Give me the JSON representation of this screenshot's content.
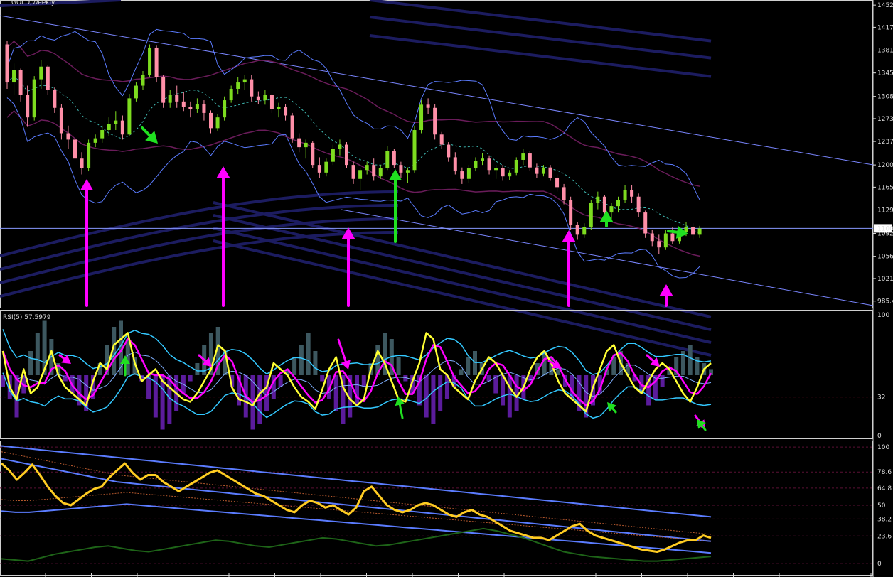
{
  "window": {
    "title": "GOLD,Weekly"
  },
  "colors": {
    "background": "#000000",
    "bull": "#7ddc1f",
    "bear": "#ff8fa8",
    "bands_blue": "#5b7cff",
    "bands_purple": "#6a1c5a",
    "trendline": "#7a86ff",
    "ema_dark": "#1c1c60",
    "arrow_magenta": "#ff00ff",
    "arrow_green": "#20e020",
    "rsi": "#ffff33",
    "rsi_bands": "#33c8ff",
    "hist_pos": "#3d5860",
    "hist_neg": "#5b1c9c",
    "stoch_main": "#ffcc22",
    "stoch_green": "#1e6418",
    "stoch_blue": "#5b7cff",
    "stoch_dashed": "#b85a2e",
    "level_dotted": "#a01030"
  },
  "chart_data": [
    {
      "type": "candlestick",
      "title": "GOLD,Weekly",
      "price_ticks": [
        "1452",
        "1417",
        "1381",
        "1345",
        "1308",
        "1273",
        "1237",
        "1200",
        "1165",
        "1129",
        "1092",
        "1056",
        "1021",
        "985.4"
      ],
      "price_tick_values": [
        1452,
        1417,
        1381,
        1345,
        1308,
        1273,
        1237,
        1200,
        1165,
        1129,
        1092,
        1056,
        1021,
        985.4
      ],
      "current_price_label": "1100",
      "current_price": 1100,
      "ylim": [
        975,
        1460
      ],
      "candles": [
        [
          1390,
          1395,
          1320,
          1330
        ],
        [
          1330,
          1360,
          1310,
          1350
        ],
        [
          1350,
          1352,
          1300,
          1310
        ],
        [
          1310,
          1325,
          1260,
          1275
        ],
        [
          1275,
          1340,
          1270,
          1335
        ],
        [
          1335,
          1365,
          1320,
          1355
        ],
        [
          1355,
          1358,
          1310,
          1318
        ],
        [
          1318,
          1322,
          1282,
          1290
        ],
        [
          1290,
          1296,
          1240,
          1250
        ],
        [
          1250,
          1262,
          1225,
          1240
        ],
        [
          1240,
          1250,
          1200,
          1210
        ],
        [
          1210,
          1220,
          1185,
          1195
        ],
        [
          1195,
          1240,
          1190,
          1235
        ],
        [
          1235,
          1248,
          1228,
          1242
        ],
        [
          1242,
          1262,
          1235,
          1255
        ],
        [
          1255,
          1275,
          1245,
          1265
        ],
        [
          1265,
          1285,
          1255,
          1270
        ],
        [
          1270,
          1278,
          1240,
          1248
        ],
        [
          1248,
          1312,
          1245,
          1305
        ],
        [
          1305,
          1330,
          1300,
          1325
        ],
        [
          1325,
          1348,
          1318,
          1342
        ],
        [
          1342,
          1390,
          1338,
          1385
        ],
        [
          1385,
          1388,
          1330,
          1338
        ],
        [
          1338,
          1342,
          1290,
          1298
        ],
        [
          1298,
          1318,
          1290,
          1310
        ],
        [
          1310,
          1325,
          1290,
          1300
        ],
        [
          1300,
          1315,
          1285,
          1292
        ],
        [
          1292,
          1300,
          1275,
          1288
        ],
        [
          1288,
          1305,
          1282,
          1296
        ],
        [
          1296,
          1302,
          1270,
          1282
        ],
        [
          1282,
          1286,
          1250,
          1258
        ],
        [
          1258,
          1280,
          1254,
          1275
        ],
        [
          1275,
          1308,
          1270,
          1302
        ],
        [
          1302,
          1325,
          1298,
          1320
        ],
        [
          1320,
          1338,
          1312,
          1330
        ],
        [
          1330,
          1342,
          1318,
          1335
        ],
        [
          1335,
          1342,
          1300,
          1308
        ],
        [
          1308,
          1316,
          1296,
          1302
        ],
        [
          1302,
          1318,
          1295,
          1310
        ],
        [
          1310,
          1312,
          1282,
          1288
        ],
        [
          1288,
          1298,
          1275,
          1292
        ],
        [
          1292,
          1296,
          1270,
          1278
        ],
        [
          1278,
          1282,
          1235,
          1242
        ],
        [
          1242,
          1250,
          1220,
          1228
        ],
        [
          1228,
          1240,
          1210,
          1235
        ],
        [
          1235,
          1238,
          1195,
          1200
        ],
        [
          1200,
          1212,
          1180,
          1188
        ],
        [
          1188,
          1210,
          1182,
          1205
        ],
        [
          1205,
          1232,
          1200,
          1225
        ],
        [
          1225,
          1240,
          1215,
          1232
        ],
        [
          1232,
          1236,
          1195,
          1200
        ],
        [
          1200,
          1205,
          1170,
          1178
        ],
        [
          1178,
          1195,
          1160,
          1192
        ],
        [
          1192,
          1205,
          1185,
          1200
        ],
        [
          1200,
          1210,
          1175,
          1182
        ],
        [
          1182,
          1200,
          1178,
          1195
        ],
        [
          1195,
          1230,
          1192,
          1222
        ],
        [
          1222,
          1225,
          1195,
          1200
        ],
        [
          1200,
          1205,
          1180,
          1188
        ],
        [
          1188,
          1196,
          1172,
          1192
        ],
        [
          1192,
          1262,
          1188,
          1255
        ],
        [
          1255,
          1302,
          1250,
          1295
        ],
        [
          1295,
          1305,
          1280,
          1290
        ],
        [
          1290,
          1296,
          1240,
          1248
        ],
        [
          1248,
          1252,
          1225,
          1232
        ],
        [
          1232,
          1236,
          1205,
          1212
        ],
        [
          1212,
          1220,
          1185,
          1190
        ],
        [
          1190,
          1196,
          1170,
          1178
        ],
        [
          1178,
          1200,
          1172,
          1195
        ],
        [
          1195,
          1212,
          1190,
          1206
        ],
        [
          1206,
          1218,
          1200,
          1210
        ],
        [
          1210,
          1215,
          1185,
          1192
        ],
        [
          1192,
          1200,
          1178,
          1195
        ],
        [
          1195,
          1200,
          1175,
          1182
        ],
        [
          1182,
          1192,
          1176,
          1188
        ],
        [
          1188,
          1212,
          1184,
          1208
        ],
        [
          1208,
          1225,
          1200,
          1218
        ],
        [
          1218,
          1222,
          1190,
          1196
        ],
        [
          1196,
          1202,
          1180,
          1186
        ],
        [
          1186,
          1200,
          1182,
          1196
        ],
        [
          1196,
          1200,
          1175,
          1180
        ],
        [
          1180,
          1185,
          1158,
          1165
        ],
        [
          1165,
          1170,
          1138,
          1145
        ],
        [
          1145,
          1150,
          1098,
          1105
        ],
        [
          1105,
          1110,
          1082,
          1090
        ],
        [
          1090,
          1108,
          1085,
          1102
        ],
        [
          1102,
          1145,
          1098,
          1140
        ],
        [
          1140,
          1158,
          1130,
          1150
        ],
        [
          1150,
          1152,
          1118,
          1125
        ],
        [
          1125,
          1140,
          1110,
          1135
        ],
        [
          1135,
          1150,
          1125,
          1145
        ],
        [
          1145,
          1168,
          1140,
          1160
        ],
        [
          1160,
          1168,
          1140,
          1150
        ],
        [
          1150,
          1155,
          1118,
          1125
        ],
        [
          1125,
          1128,
          1085,
          1092
        ],
        [
          1092,
          1098,
          1072,
          1080
        ],
        [
          1080,
          1090,
          1060,
          1070
        ],
        [
          1070,
          1098,
          1066,
          1092
        ],
        [
          1092,
          1102,
          1075,
          1080
        ],
        [
          1080,
          1098,
          1076,
          1094
        ],
        [
          1094,
          1110,
          1088,
          1102
        ],
        [
          1102,
          1108,
          1082,
          1090
        ],
        [
          1090,
          1104,
          1085,
          1100
        ]
      ]
    },
    {
      "type": "line",
      "title": "RSI(5) 57.5979",
      "ticks": [
        "100",
        "32",
        "0"
      ],
      "tick_values": [
        100,
        32,
        0
      ],
      "ylim": [
        0,
        100
      ],
      "level": 32,
      "rsi": [
        70,
        40,
        30,
        55,
        35,
        40,
        55,
        70,
        50,
        40,
        35,
        30,
        25,
        45,
        60,
        55,
        75,
        80,
        85,
        60,
        45,
        50,
        55,
        45,
        40,
        35,
        30,
        28,
        35,
        45,
        55,
        75,
        70,
        40,
        30,
        28,
        25,
        35,
        40,
        60,
        55,
        50,
        40,
        32,
        28,
        22,
        38,
        55,
        65,
        40,
        30,
        25,
        30,
        55,
        70,
        60,
        45,
        30,
        28,
        45,
        60,
        85,
        80,
        55,
        50,
        40,
        35,
        30,
        45,
        55,
        65,
        60,
        50,
        40,
        32,
        40,
        55,
        65,
        70,
        60,
        45,
        35,
        30,
        25,
        20,
        40,
        55,
        70,
        75,
        60,
        50,
        40,
        35,
        45,
        55,
        60,
        55,
        45,
        35,
        28,
        40,
        55,
        60
      ],
      "histogram": [
        -10,
        -20,
        -35,
        -15,
        20,
        35,
        45,
        30,
        10,
        -5,
        -15,
        -25,
        -30,
        -20,
        10,
        25,
        40,
        45,
        30,
        15,
        -5,
        -20,
        -35,
        -45,
        -40,
        -30,
        -15,
        -5,
        10,
        25,
        35,
        40,
        20,
        -10,
        -25,
        -35,
        -45,
        -40,
        -30,
        -20,
        -10,
        5,
        15,
        25,
        35,
        20,
        -5,
        -20,
        -30,
        -40,
        -35,
        -25,
        -10,
        10,
        25,
        35,
        30,
        15,
        -5,
        -15,
        -25,
        -35,
        -40,
        -30,
        -20,
        -10,
        5,
        15,
        20,
        10,
        -5,
        -15,
        -25,
        -35,
        -30,
        -20,
        -5,
        10,
        20,
        15,
        5,
        -10,
        -20,
        -30,
        -35,
        -25,
        -15,
        5,
        15,
        20,
        10,
        -5,
        -15,
        -25,
        -20,
        -10,
        5,
        15,
        20,
        25,
        15,
        10,
        5
      ]
    },
    {
      "type": "line",
      "title": "",
      "ticks": [
        "100",
        "78.6",
        "64.8",
        "50",
        "38.2",
        "23.6",
        "0"
      ],
      "tick_values": [
        100,
        78.6,
        64.8,
        50,
        38.2,
        23.6,
        0
      ],
      "ylim": [
        -8,
        105
      ],
      "main": [
        86,
        80,
        72,
        78,
        85,
        76,
        66,
        58,
        52,
        50,
        55,
        60,
        64,
        66,
        74,
        80,
        86,
        78,
        72,
        76,
        76,
        70,
        66,
        62,
        66,
        70,
        74,
        78,
        80,
        76,
        72,
        68,
        64,
        60,
        58,
        54,
        50,
        46,
        44,
        50,
        54,
        52,
        48,
        50,
        46,
        42,
        48,
        62,
        66,
        58,
        50,
        46,
        44,
        46,
        50,
        52,
        50,
        46,
        42,
        40,
        44,
        46,
        42,
        40,
        36,
        32,
        28,
        26,
        24,
        22,
        22,
        20,
        24,
        28,
        32,
        34,
        28,
        24,
        22,
        20,
        18,
        16,
        14,
        12,
        11,
        10,
        12,
        15,
        18,
        20,
        20,
        24,
        22
      ],
      "upper": [
        101,
        100,
        99,
        98,
        97,
        96,
        95,
        94,
        93,
        92,
        91,
        90,
        89,
        88,
        87,
        86,
        85,
        84,
        83,
        82,
        81,
        80,
        79,
        78,
        77,
        76,
        75,
        74,
        73,
        72,
        71,
        70,
        69,
        68,
        67,
        66,
        65,
        64,
        63,
        62,
        61,
        60,
        59,
        58,
        57,
        56,
        55,
        54,
        53,
        52,
        51,
        50,
        49,
        48,
        47,
        46,
        45,
        44,
        43,
        42,
        41,
        40
      ],
      "mid": [
        90,
        88,
        86,
        84,
        82,
        80,
        78,
        76,
        74,
        72,
        70,
        69,
        68,
        67,
        66,
        65,
        64,
        63,
        62,
        61,
        60,
        59,
        58,
        57,
        56,
        55,
        54,
        53,
        52,
        51,
        50,
        49,
        48,
        47,
        46,
        45,
        44,
        43,
        42,
        41,
        40,
        39,
        38,
        37,
        36,
        35,
        34,
        33,
        32,
        31,
        30,
        29,
        28,
        27,
        26,
        25,
        24,
        23,
        22,
        21,
        20,
        19
      ],
      "lower": [
        45,
        44,
        44,
        45,
        46,
        47,
        48,
        49,
        50,
        51,
        50,
        49,
        48,
        47,
        46,
        45,
        44,
        43,
        42,
        41,
        40,
        39,
        38,
        37,
        36,
        35,
        34,
        33,
        32,
        31,
        30,
        29,
        28,
        27,
        26,
        25,
        24,
        23,
        22,
        21,
        20,
        19,
        18,
        17,
        16,
        15,
        14,
        13,
        12,
        11,
        10,
        9
      ],
      "green": [
        4,
        3,
        2,
        5,
        8,
        10,
        12,
        14,
        15,
        13,
        11,
        10,
        12,
        14,
        16,
        18,
        20,
        19,
        17,
        15,
        14,
        16,
        18,
        20,
        22,
        21,
        19,
        17,
        15,
        16,
        18,
        20,
        22,
        24,
        26,
        28,
        30,
        28,
        25,
        22,
        18,
        14,
        10,
        8,
        6,
        5,
        4,
        3,
        2,
        2,
        3,
        4,
        5,
        6
      ]
    }
  ]
}
